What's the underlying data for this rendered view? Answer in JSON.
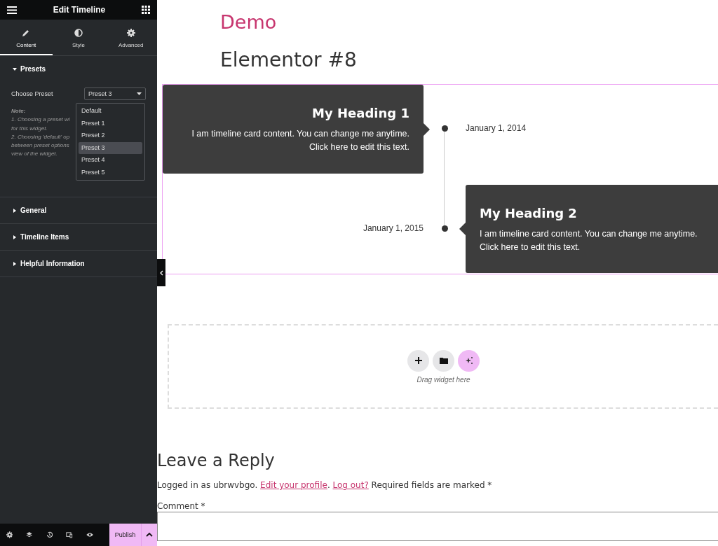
{
  "sidebar": {
    "title": "Edit Timeline",
    "tabs": [
      {
        "label": "Content",
        "selected": true
      },
      {
        "label": "Style",
        "selected": false
      },
      {
        "label": "Advanced",
        "selected": false
      }
    ],
    "sections": [
      {
        "title": "Presets",
        "expanded": true
      },
      {
        "title": "General",
        "expanded": false
      },
      {
        "title": "Timeline Items",
        "expanded": false
      },
      {
        "title": "Helpful Information",
        "expanded": false
      }
    ],
    "preset_label": "Choose Preset",
    "preset_value": "Preset 3",
    "note_lines": [
      "Note:",
      "1. Choosing a preset wi",
      "for this widget.",
      "2. Choosing 'default' op",
      "between preset options",
      "view of the widget."
    ],
    "preset_options": [
      {
        "label": "Default",
        "selected": false
      },
      {
        "label": "Preset 1",
        "selected": false
      },
      {
        "label": "Preset 2",
        "selected": false
      },
      {
        "label": "Preset 3",
        "selected": true
      },
      {
        "label": "Preset 4",
        "selected": false
      },
      {
        "label": "Preset 5",
        "selected": false
      }
    ],
    "publish": "Publish"
  },
  "page": {
    "site_title": "Demo",
    "heading": "Elementor #8",
    "timeline": [
      {
        "heading": "My Heading 1",
        "text": "I am timeline card content. You can change me anytime. Click here to edit this text.",
        "date": "January 1, 2014"
      },
      {
        "heading": "My Heading 2",
        "text": "I am timeline card content. You can change me anytime. Click here to edit this text.",
        "date": "January 1, 2015"
      }
    ],
    "drop_hint": "Drag widget here",
    "reply_title": "Leave a Reply",
    "logged_in": "Logged in as ubrwvbgo.",
    "edit_profile": "Edit your profile",
    "link_separator": ".",
    "log_out": "Log out?",
    "required": "Required fields are marked *",
    "comment_label": "Comment *"
  }
}
